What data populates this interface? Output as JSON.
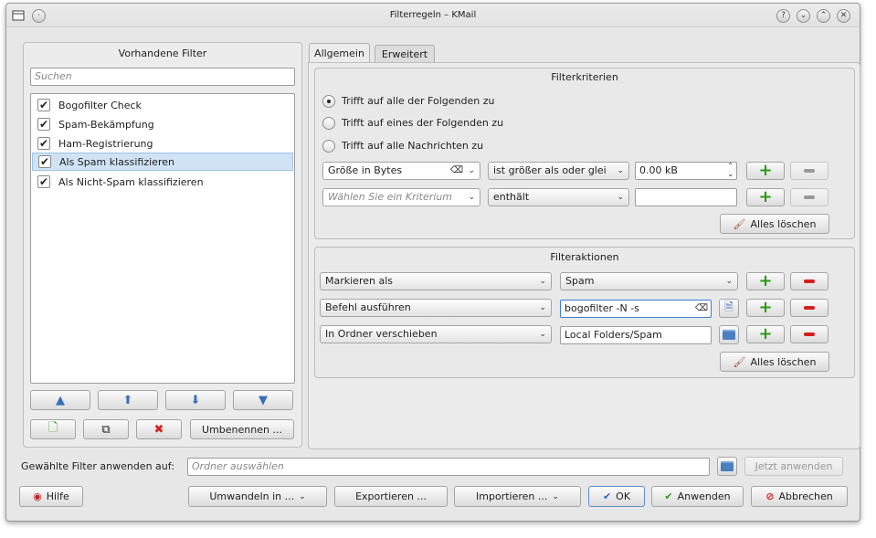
{
  "window": {
    "title": "Filterregeln – KMail"
  },
  "left": {
    "heading": "Vorhandene Filter",
    "search_placeholder": "Suchen",
    "filters": [
      {
        "label": "Bogofilter Check",
        "checked": true,
        "selected": false
      },
      {
        "label": "Spam-Bekämpfung",
        "checked": true,
        "selected": false
      },
      {
        "label": "Ham-Registrierung",
        "checked": true,
        "selected": false
      },
      {
        "label": "Als Spam klassifizieren",
        "checked": true,
        "selected": true
      },
      {
        "label": "Als Nicht-Spam klassifizieren",
        "checked": true,
        "selected": false
      }
    ],
    "rename_label": "Umbenennen ..."
  },
  "tabs": [
    {
      "label": "Allgemein"
    },
    {
      "label": "Erweitert"
    }
  ],
  "criteria": {
    "heading": "Filterkriterien",
    "options": [
      "Trifft auf alle der Folgenden zu",
      "Trifft auf eines der Folgenden zu",
      "Trifft auf alle Nachrichten zu"
    ],
    "rows": [
      {
        "field": "Größe in Bytes",
        "op": "ist größer als oder glei",
        "value": "0.00 kB"
      },
      {
        "field": "Wählen Sie ein Kriterium",
        "op": "enthält",
        "value": ""
      }
    ],
    "clear_label": "Alles löschen"
  },
  "actions": {
    "heading": "Filteraktionen",
    "rows": [
      {
        "action": "Markieren als",
        "value": "Spam"
      },
      {
        "action": "Befehl ausführen",
        "value": "bogofilter -N -s"
      },
      {
        "action": "In Ordner verschieben",
        "value": "Local Folders/Spam"
      }
    ],
    "clear_label": "Alles löschen"
  },
  "apply": {
    "label": "Gewählte Filter anwenden auf:",
    "placeholder": "Ordner auswählen",
    "now_label": "Jetzt anwenden"
  },
  "footer": {
    "help": "Hilfe",
    "convert": "Umwandeln in ...",
    "export": "Exportieren ...",
    "import": "Importieren ...",
    "ok": "OK",
    "apply": "Anwenden",
    "cancel": "Abbrechen"
  }
}
